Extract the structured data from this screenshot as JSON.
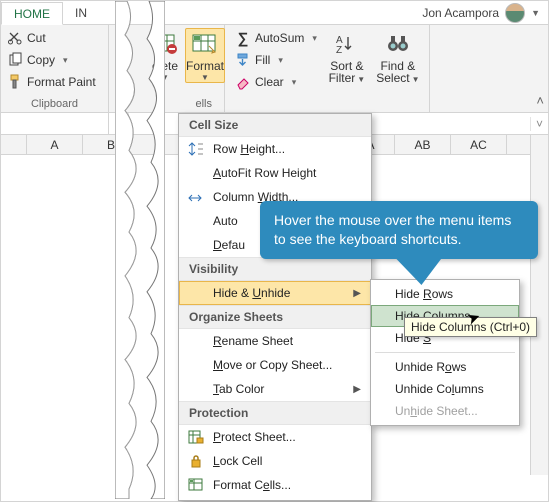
{
  "tabs": {
    "home": "HOME",
    "insert_partial": "IN"
  },
  "user": {
    "name": "Jon Acampora"
  },
  "clipboard": {
    "cut": "Cut",
    "copy": "Copy",
    "paint": "Format Paint",
    "group_label": "Clipboard"
  },
  "cells": {
    "delete_partial": "elete",
    "format": "Format",
    "group_label_partial": "ells"
  },
  "editing": {
    "autosum": "AutoSum",
    "fill": "Fill",
    "clear": "Clear",
    "sortfilter_l1": "Sort &",
    "sortfilter_l2": "Filter",
    "findselect_l1": "Find &",
    "findselect_l2": "Select"
  },
  "columns": {
    "a": "A",
    "b": "B",
    "aa": "AA",
    "ab": "AB",
    "ac": "AC"
  },
  "format_menu": {
    "sect_cellsize": "Cell Size",
    "row_height_pre": "Row ",
    "row_height_u": "H",
    "row_height_post": "eight...",
    "autofit_row_pre": "",
    "autofit_row_u": "A",
    "autofit_row_post": "utoFit Row Height",
    "col_width_pre": "Column ",
    "col_width_u": "W",
    "col_width_post": "idth...",
    "autofit_col_partial": "Auto",
    "default_width_partial_pre": "",
    "default_width_partial_u": "D",
    "default_width_partial_post": "efau",
    "sect_visibility": "Visibility",
    "hide_unhide_pre": "Hide & ",
    "hide_unhide_u": "U",
    "hide_unhide_post": "nhide",
    "sect_organize": "Organize Sheets",
    "rename_pre": "",
    "rename_u": "R",
    "rename_post": "ename Sheet",
    "movecopy_pre": "",
    "movecopy_u": "M",
    "movecopy_post": "ove or Copy Sheet...",
    "tabcolor_pre": "",
    "tabcolor_u": "T",
    "tabcolor_post": "ab Color",
    "sect_protection": "Protection",
    "protect_pre": "",
    "protect_u": "P",
    "protect_post": "rotect Sheet...",
    "lock_pre": "",
    "lock_u": "L",
    "lock_post": "ock Cell",
    "formatcells_pre": "Format C",
    "formatcells_u": "e",
    "formatcells_post": "lls..."
  },
  "submenu": {
    "hide_rows_pre": "Hide ",
    "hide_rows_u": "R",
    "hide_rows_post": "ows",
    "hide_cols_pre": "Hide Col",
    "hide_cols_u": "u",
    "hide_cols_post": "mns",
    "hide_sheet_partial_pre": "Hide ",
    "hide_sheet_partial_u": "S",
    "unhide_rows_pre": "Unhide R",
    "unhide_rows_u": "o",
    "unhide_rows_post": "ws",
    "unhide_cols_pre": "Unhide Co",
    "unhide_cols_u": "l",
    "unhide_cols_post": "umns",
    "unhide_sheet_pre": "Un",
    "unhide_sheet_u": "h",
    "unhide_sheet_post": "ide Sheet..."
  },
  "callout": {
    "text": "Hover the mouse over the menu items to see the keyboard shortcuts."
  },
  "tooltip": {
    "text": "Hide Columns (Ctrl+0)"
  }
}
